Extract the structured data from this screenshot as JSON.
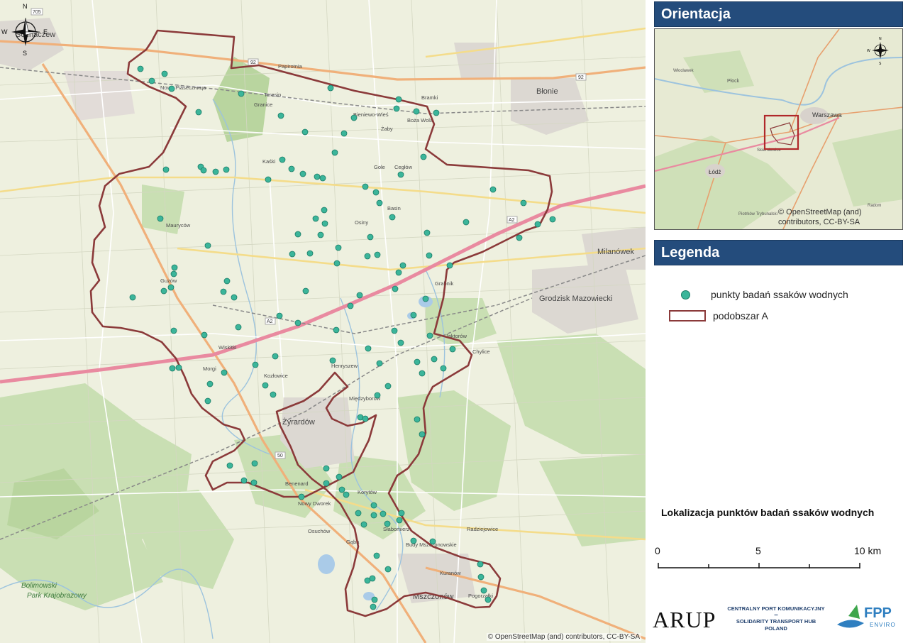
{
  "map": {
    "attribution": "© OpenStreetMap (and) contributors, CC-BY-SA",
    "places": [
      {
        "name": "Sochaczew",
        "big": true
      },
      {
        "name": "Błonie",
        "big": true
      },
      {
        "name": "Żyrardów",
        "big": true
      },
      {
        "name": "Mszczonów",
        "big": true
      },
      {
        "name": "Wiskitki",
        "big": false
      },
      {
        "name": "Milanówek",
        "big": true
      },
      {
        "name": "Grodzisk Mazowiecki",
        "big": true
      },
      {
        "name": "Teresin",
        "big": false
      },
      {
        "name": "Papirotnia",
        "big": false
      },
      {
        "name": "Granice",
        "big": false
      },
      {
        "name": "Nowa Piaseczница",
        "big": false
      },
      {
        "name": "Kaśki",
        "big": false
      },
      {
        "name": "Bieniewo-Wieś",
        "big": false
      },
      {
        "name": "Bramki",
        "big": false
      },
      {
        "name": "Żaby",
        "big": false
      },
      {
        "name": "Boża Wola",
        "big": false
      },
      {
        "name": "Gole",
        "big": false
      },
      {
        "name": "Cegłów",
        "big": false
      },
      {
        "name": "Osiny",
        "big": false
      },
      {
        "name": "Basin",
        "big": false
      },
      {
        "name": "Grabnik",
        "big": false
      },
      {
        "name": "Jaktorów",
        "big": false
      },
      {
        "name": "Chylice",
        "big": false
      },
      {
        "name": "Międzyborów",
        "big": false
      },
      {
        "name": "Henryszew",
        "big": false
      },
      {
        "name": "Morgi",
        "big": false
      },
      {
        "name": "Guzów",
        "big": false
      },
      {
        "name": "Mauryców",
        "big": false
      },
      {
        "name": "Kozłowice",
        "big": false
      },
      {
        "name": "Osuchów",
        "big": false
      },
      {
        "name": "Radziejowice",
        "big": false
      },
      {
        "name": "Kuranów",
        "big": false
      },
      {
        "name": "Pogorzałki",
        "big": false
      },
      {
        "name": "Korytów",
        "big": false
      },
      {
        "name": "Nowy Dworek",
        "big": false
      },
      {
        "name": "Słabomierz",
        "big": false
      },
      {
        "name": "Budy Mszczonowskie",
        "big": false
      },
      {
        "name": "Gąba",
        "big": false
      },
      {
        "name": "Benenard",
        "big": false
      }
    ],
    "park_label": "Bolimowski Park Krajobrazowy",
    "road_labels": [
      "92",
      "92",
      "A2",
      "A2",
      "50",
      "705"
    ]
  },
  "north_arrow": {
    "n": "N",
    "s": "S",
    "e": "E",
    "w": "W"
  },
  "orientation": {
    "title": "Orientacja",
    "attribution_line1": "© OpenStreetMap (and)",
    "attribution_line2": "contributors, CC-BY-SA",
    "places": [
      "Płock",
      "Warszawa",
      "Łódź",
      "Skierniewice",
      "Piotrków Trybunalski",
      "Włocławek",
      "Radom"
    ]
  },
  "legend": {
    "title": "Legenda",
    "points_label": "punkty badań ssaków wodnych",
    "area_label": "podobszar A",
    "point_color": "#3bb59a",
    "area_color": "#8b3a3a"
  },
  "map_title": "Lokalizacja punktów badań ssaków wodnych",
  "scale": {
    "labels": [
      "0",
      "5",
      "10 km"
    ]
  },
  "logos": {
    "arup": "ARUP",
    "cpk_line1": "CENTRALNY PORT KOMUNIKACYJNY",
    "cpk_line2": "SOLIDARITY TRANSPORT HUB",
    "cpk_line3": "POLAND",
    "fpp": "FPP",
    "fpp_sub": "ENVIRO"
  }
}
